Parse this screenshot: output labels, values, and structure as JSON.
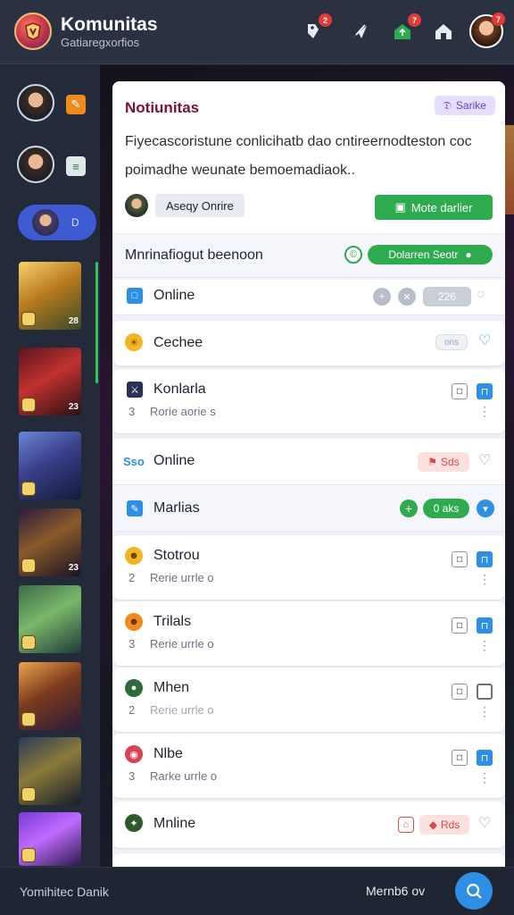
{
  "header": {
    "title": "Komunitas",
    "subtitle": "Gatiaregxorfios",
    "logo_icon": "game-logo",
    "icons": [
      {
        "name": "controller-icon",
        "badge": "2"
      },
      {
        "name": "send-icon",
        "badge": ""
      },
      {
        "name": "home-icon",
        "badge": "7"
      },
      {
        "name": "house-icon",
        "badge": ""
      }
    ],
    "avatar_badge": "7"
  },
  "rail": {
    "pill_label": "D",
    "thumbs": [
      {
        "label": "28"
      },
      {
        "label": "23"
      },
      {
        "label": ""
      },
      {
        "label": "23"
      },
      {
        "label": ""
      },
      {
        "label": ""
      },
      {
        "label": ""
      },
      {
        "label": ""
      }
    ]
  },
  "hero": {
    "title": "Notiunitas",
    "tag": "Sarike",
    "description": "Fiyecascoristune conlicihatb dao cntireernodteston coc poimadhe weunate bemoemadiaok..",
    "user_name": "Aseqy Onrire",
    "cta": "Mote darlier"
  },
  "featured": {
    "title": "Mnrinafiogut beenoon",
    "button": "Dolarren Seotr"
  },
  "online_header": {
    "title": "Online",
    "count": "226"
  },
  "rows": [
    {
      "title": "Cechee",
      "pill": "ons"
    },
    {
      "title": "Konlarla",
      "sub_num": "3",
      "sub": "Rorie aorie s"
    },
    {
      "title": "Online",
      "prefix": "Sso",
      "pill": "Sds"
    },
    {
      "title": "Marlias",
      "pill": "0 aks"
    },
    {
      "title": "Stotrou",
      "sub_num": "2",
      "sub": "Rerie urrle o"
    },
    {
      "title": "Trilals",
      "sub_num": "3",
      "sub": "Rerie urrle o"
    },
    {
      "title": "Mhen",
      "sub_num": "2",
      "sub": "Rerie urrle o"
    },
    {
      "title": "Nlbe",
      "sub_num": "3",
      "sub": "Rarke urrle o"
    },
    {
      "title": "Mnline",
      "pill": "Rds"
    }
  ],
  "bottom": {
    "left": "Yomihitec Danik",
    "right": "Mernb6 ov"
  },
  "colors": {
    "accent_green": "#2eaa4f",
    "accent_blue": "#2d8fe6",
    "accent_red": "#e53935",
    "hero_title": "#7a1232"
  }
}
